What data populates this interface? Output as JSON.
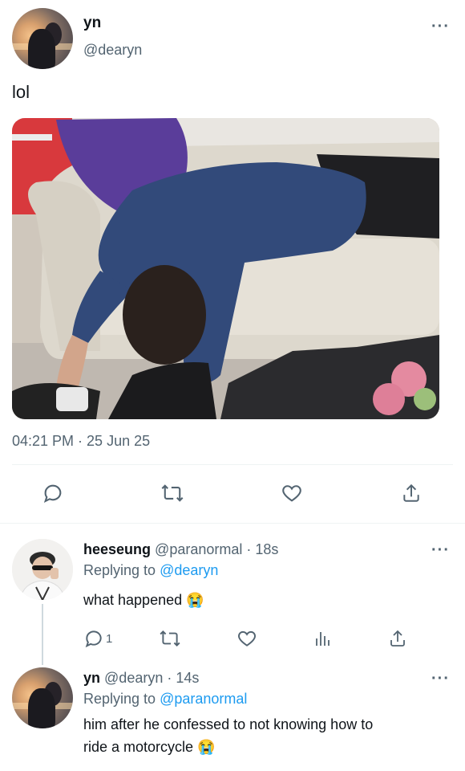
{
  "main_tweet": {
    "display_name": "yn",
    "handle": "@dearyn",
    "text": "lol",
    "timestamp": "04:21 PM · 25 Jun 25"
  },
  "actions": [
    "reply-icon",
    "retweet-icon",
    "like-icon",
    "share-icon"
  ],
  "reply1": {
    "display_name": "heeseung",
    "handle": "@paranormal",
    "time": "18s",
    "replying_prefix": "Replying to",
    "replying_to": "@dearyn",
    "text": "what happened 😭",
    "reply_count": "1"
  },
  "reply2": {
    "display_name": "yn",
    "handle": "@dearyn",
    "time": "14s",
    "replying_prefix": "Replying to",
    "replying_to": "@paranormal",
    "text_line1": "him after he confessed to not knowing how to",
    "text_line2": "ride a motorcycle 😭"
  },
  "colors": {
    "text": "#0f1419",
    "muted": "#536471",
    "link": "#1d9bf0",
    "divider": "#eff3f4"
  }
}
